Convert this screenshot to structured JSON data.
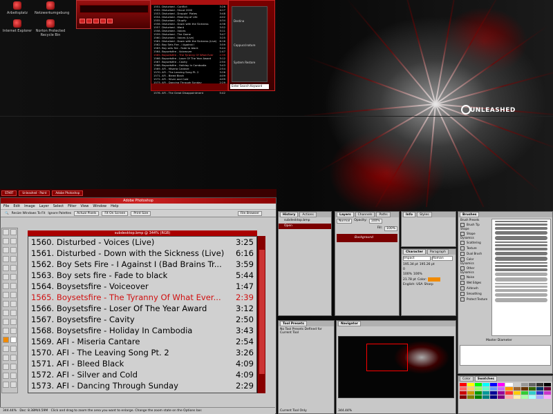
{
  "desktop": {
    "icons": [
      {
        "label": "Arbeitsplatz"
      },
      {
        "label": "Netzwerkumgebung"
      },
      {
        "label": "Internet Explorer"
      },
      {
        "label": "Norton Protected Recycle Bin"
      }
    ],
    "brand": "UNLEASHED"
  },
  "taskbar": {
    "start_label": "START",
    "items": [
      "Unleashed - Paint",
      "Adobe Photoshop"
    ]
  },
  "playlist_mini": {
    "rows": [
      {
        "name": "1551. Disturbed - Conflict",
        "time": "3:26"
      },
      {
        "name": "1552. Disturbed - Shout 2000",
        "time": "4:17"
      },
      {
        "name": "1553. Disturbed - Droppin' Plates",
        "time": "3:48"
      },
      {
        "name": "1554. Disturbed - Meaning of Life",
        "time": "4:02"
      },
      {
        "name": "1555. Disturbed - Stupify",
        "time": "4:34"
      },
      {
        "name": "1556. Disturbed - Down with the Sickness",
        "time": "4:38"
      },
      {
        "name": "1557. Disturbed - Want",
        "time": "3:52"
      },
      {
        "name": "1558. Disturbed - Voices",
        "time": "3:11"
      },
      {
        "name": "1559. Disturbed - The Game",
        "time": "3:47"
      },
      {
        "name": "1560. Disturbed - Voices (Live)",
        "time": "3:25"
      },
      {
        "name": "1561. Disturbed - Down with the Sickness (Live)",
        "time": "6:16"
      },
      {
        "name": "1562. Boy Sets Fire - I Against I",
        "time": "3:59"
      },
      {
        "name": "1563. Boy sets fire - Fade to black",
        "time": "5:44"
      },
      {
        "name": "1564. Boysetsfire - Voiceover",
        "time": "1:47"
      },
      {
        "name": "1565. Boysetsfire - The Tyranny Of What Ever",
        "time": "2:39",
        "active": true
      },
      {
        "name": "1566. Boysetsfire - Loser Of The Year Award",
        "time": "3:12"
      },
      {
        "name": "1567. Boysetsfire - Cavity",
        "time": "2:50"
      },
      {
        "name": "1568. Boysetsfire - Holiday In Cambodia",
        "time": "3:43"
      },
      {
        "name": "1569. AFI - Miseria Cantare",
        "time": "2:54"
      },
      {
        "name": "1570. AFI - The Leaving Song Pt. 2",
        "time": "3:26"
      },
      {
        "name": "1571. AFI - Bleed Black",
        "time": "4:09"
      },
      {
        "name": "1572. AFI - Silver and Cold",
        "time": "4:09"
      },
      {
        "name": "1573. AFI - Dancing Through Sunday",
        "time": "2:29"
      },
      {
        "name": "1574. AFI - Girl's Not Grey",
        "time": "3:11"
      },
      {
        "name": "1575. AFI - Death of Seasons",
        "time": "4:25"
      },
      {
        "name": "1576. AFI - The Great Disappointment",
        "time": "5:42"
      }
    ]
  },
  "side_panel": {
    "labels": [
      "Destina",
      "Cappuccinature",
      "System Restore"
    ],
    "search_placeholder": "Enter Search Keyword"
  },
  "photoshop": {
    "title": "Adobe Photoshop",
    "menu": [
      "File",
      "Edit",
      "Image",
      "Layer",
      "Select",
      "Filter",
      "View",
      "Window",
      "Help"
    ],
    "options": {
      "resize_label": "Resize Windows To Fit",
      "ignore_label": "Ignore Palettes",
      "actual": "Actual Pixels",
      "fit": "Fit On Screen",
      "print": "Print Size",
      "file_browser": "File Browser"
    },
    "doc_title": "subdesktop.bmp @ 344% (RGB)",
    "canvas_rows": [
      {
        "name": "1560. Disturbed - Voices (Live)",
        "time": "3:25"
      },
      {
        "name": "1561. Disturbed - Down with the Sickness (Live)",
        "time": "6:16"
      },
      {
        "name": "1562. Boy Sets Fire - I Against I (Bad Brains Tr...",
        "time": "3:59"
      },
      {
        "name": "1563. Boy sets fire - Fade to black",
        "time": "5:44"
      },
      {
        "name": "1564. Boysetsfire - Voiceover",
        "time": "1:47"
      },
      {
        "name": "1565. Boysetsfire - The Tyranny Of What Ever...",
        "time": "2:39",
        "active": true
      },
      {
        "name": "1566. Boysetsfire - Loser Of The Year Award",
        "time": "3:12"
      },
      {
        "name": "1567. Boysetsfire - Cavity",
        "time": "2:50"
      },
      {
        "name": "1568. Boysetsfire - Holiday In Cambodia",
        "time": "3:43"
      },
      {
        "name": "1569. AFI - Miseria Cantare",
        "time": "2:54"
      },
      {
        "name": "1570. AFI - The Leaving Song Pt. 2",
        "time": "3:26"
      },
      {
        "name": "1571. AFI - Bleed Black",
        "time": "4:09"
      },
      {
        "name": "1572. AFI - Silver and Cold",
        "time": "4:09"
      },
      {
        "name": "1573. AFI - Dancing Through Sunday",
        "time": "2:29"
      }
    ],
    "status": "Doc: 8.38M/4.59M",
    "status_hint": "Click and drag to zoom the area you want to enlarge. Change the zoom state on the Options bar.",
    "zoom": "344.44%"
  },
  "panels": {
    "history": {
      "tabs": [
        "History",
        "Actions"
      ],
      "items": [
        "subdesktop.bmp",
        "Open"
      ]
    },
    "layers": {
      "tabs": [
        "Layers",
        "Channels",
        "Paths"
      ],
      "mode": "Normal",
      "opacity_label": "Opacity:",
      "opacity": "100%",
      "fill_label": "Fill:",
      "fill": "100%",
      "layer": "Background"
    },
    "info": {
      "tabs": [
        "Info",
        "Styles"
      ]
    },
    "character": {
      "tabs": [
        "Character",
        "Paragraph"
      ],
      "font": "Impact",
      "style": "Roman",
      "size": "195.34 pt",
      "leading": "195.26 pt",
      "tracking": "0",
      "scale_v": "100%",
      "scale_h": "100%",
      "baseline": "21.78 pt",
      "color_label": "Color:",
      "lang": "English: USA",
      "aa": "Sharp"
    },
    "brushes": {
      "tabs": [
        "Brushes"
      ],
      "options": [
        "Brush Presets",
        "Brush Tip Shape",
        "Shape Dynamics",
        "Scattering",
        "Texture",
        "Dual Brush",
        "Color Dynamics",
        "Other Dynamics",
        "Noise",
        "Wet Edges",
        "Airbrush",
        "Smoothing",
        "Protect Texture"
      ],
      "master_label": "Master Diameter"
    },
    "tool_presets": {
      "tabs": [
        "Tool Presets"
      ],
      "empty": "No Tool Presets Defined for Current Tool",
      "current_only": "Current Tool Only"
    },
    "navigator": {
      "tabs": [
        "Navigator"
      ],
      "zoom": "344.44%"
    },
    "swatches": {
      "tabs": [
        "Color",
        "Swatches"
      ]
    }
  },
  "colors": {
    "accent_red": "#c01010",
    "foreground": "#f08a00",
    "active_track": "#d01010"
  }
}
